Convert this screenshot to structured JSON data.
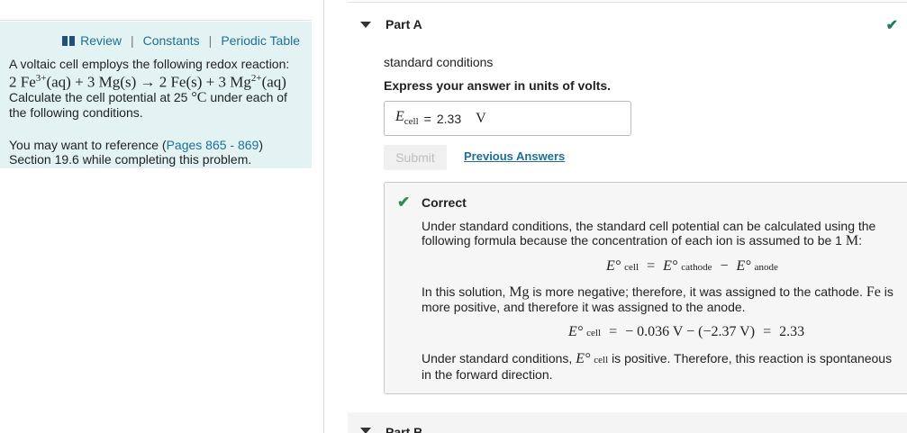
{
  "left": {
    "links": [
      "Review",
      "Constants",
      "Periodic Table"
    ],
    "intro": "A voltaic cell employs the following redox reaction:",
    "reaction": {
      "r1_coef": "2 Fe",
      "r1_charge": "3+",
      "r1_state": "(aq) + 3 Mg(s) → 2 Fe(s) + 3 Mg",
      "r2_charge": "2+",
      "r2_state": "(aq)"
    },
    "task_pre": "Calculate the cell potential at 25",
    "task_deg": "°C",
    "task_post": "under each of the following conditions.",
    "note_pre": "You may want to reference (",
    "note_link": "Pages 865 - 869",
    "note_post": ") Section 19.6 while completing this problem."
  },
  "partA": {
    "title": "Part A",
    "condition": "standard conditions",
    "instruction": "Express your answer in units of volts.",
    "answer_lhs": "E",
    "answer_sub": "cell",
    "answer_eq": "=",
    "answer_value": "2.33",
    "answer_unit": "V",
    "submit_label": "Submit",
    "prev_label": "Previous Answers"
  },
  "feedback": {
    "title": "Correct",
    "p1": "Under standard conditions, the standard cell potential can be calculated using the following formula because the concentration of each ion is assumed to be 1",
    "p1_unit": "M",
    "p1_end": ":",
    "eq1": {
      "a": "E°",
      "a_sub": "cell",
      "b": "E°",
      "b_sub": "cathode",
      "c": "E°",
      "c_sub": "anode"
    },
    "p2_a": "In this solution,",
    "p2_mg": "Mg",
    "p2_b": "is more negative; therefore, it was assigned to the cathode.",
    "p2_fe": "Fe",
    "p2_c": "is more positive, and therefore it was assigned to the anode.",
    "eq2": {
      "lhs": "E°",
      "lhs_sub": "cell",
      "rhs": "− 0.036 V − (−2.37 V)",
      "result": "2.33"
    },
    "p3_a": "Under standard conditions,",
    "p3_sym": "E°",
    "p3_sub": "cell",
    "p3_b": "is positive. Therefore, this reaction is spontaneous in the forward direction."
  },
  "partB": {
    "title": "Part B"
  }
}
